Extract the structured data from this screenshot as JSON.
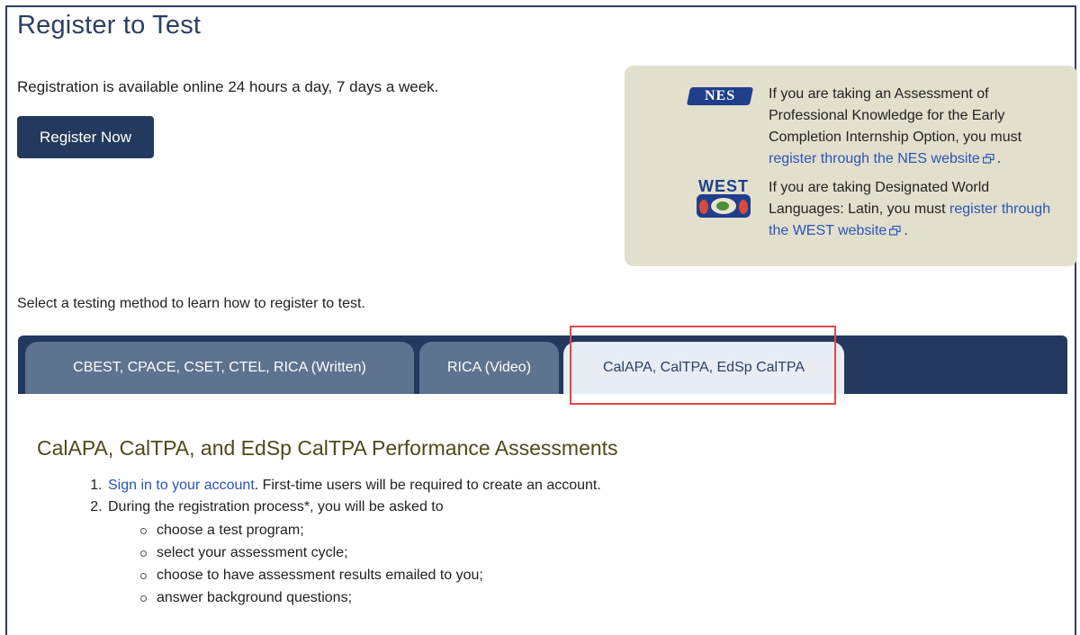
{
  "page": {
    "title": "Register to Test",
    "availability": "Registration is available online 24 hours a day, 7 days a week.",
    "register_button": "Register Now",
    "select_method": "Select a testing method to learn how to register to test."
  },
  "info_box": {
    "nes_logo": "NES",
    "west_logo": "WEST",
    "nes_text": "If you are taking an Assessment of Professional Knowledge for the Early Completion Internship Option, you must ",
    "nes_link": "register through the NES website",
    "nes_tail": ".",
    "west_text": "If you are taking Designated World Languages: Latin, you must ",
    "west_link": "register through the WEST website",
    "west_tail": "."
  },
  "tabs": [
    {
      "label": "CBEST, CPACE, CSET, CTEL, RICA (Written)",
      "active": false
    },
    {
      "label": "RICA (Video)",
      "active": false
    },
    {
      "label": "CalAPA, CalTPA, EdSp CalTPA",
      "active": true
    }
  ],
  "content": {
    "heading": "CalAPA, CalTPA, and EdSp CalTPA Performance Assessments",
    "step1_link": "Sign in to your account",
    "step1_text": ". First-time users will be required to create an account.",
    "step2_text": "During the registration process*, you will be asked to",
    "sub_items": [
      "choose a test program;",
      "select your assessment cycle;",
      "choose to have assessment results emailed to you;",
      "answer background questions;"
    ]
  },
  "colors": {
    "nav": "#233a5e",
    "info_bg": "#e3dfcd",
    "link": "#2b54b8",
    "highlight": "#e04848"
  }
}
